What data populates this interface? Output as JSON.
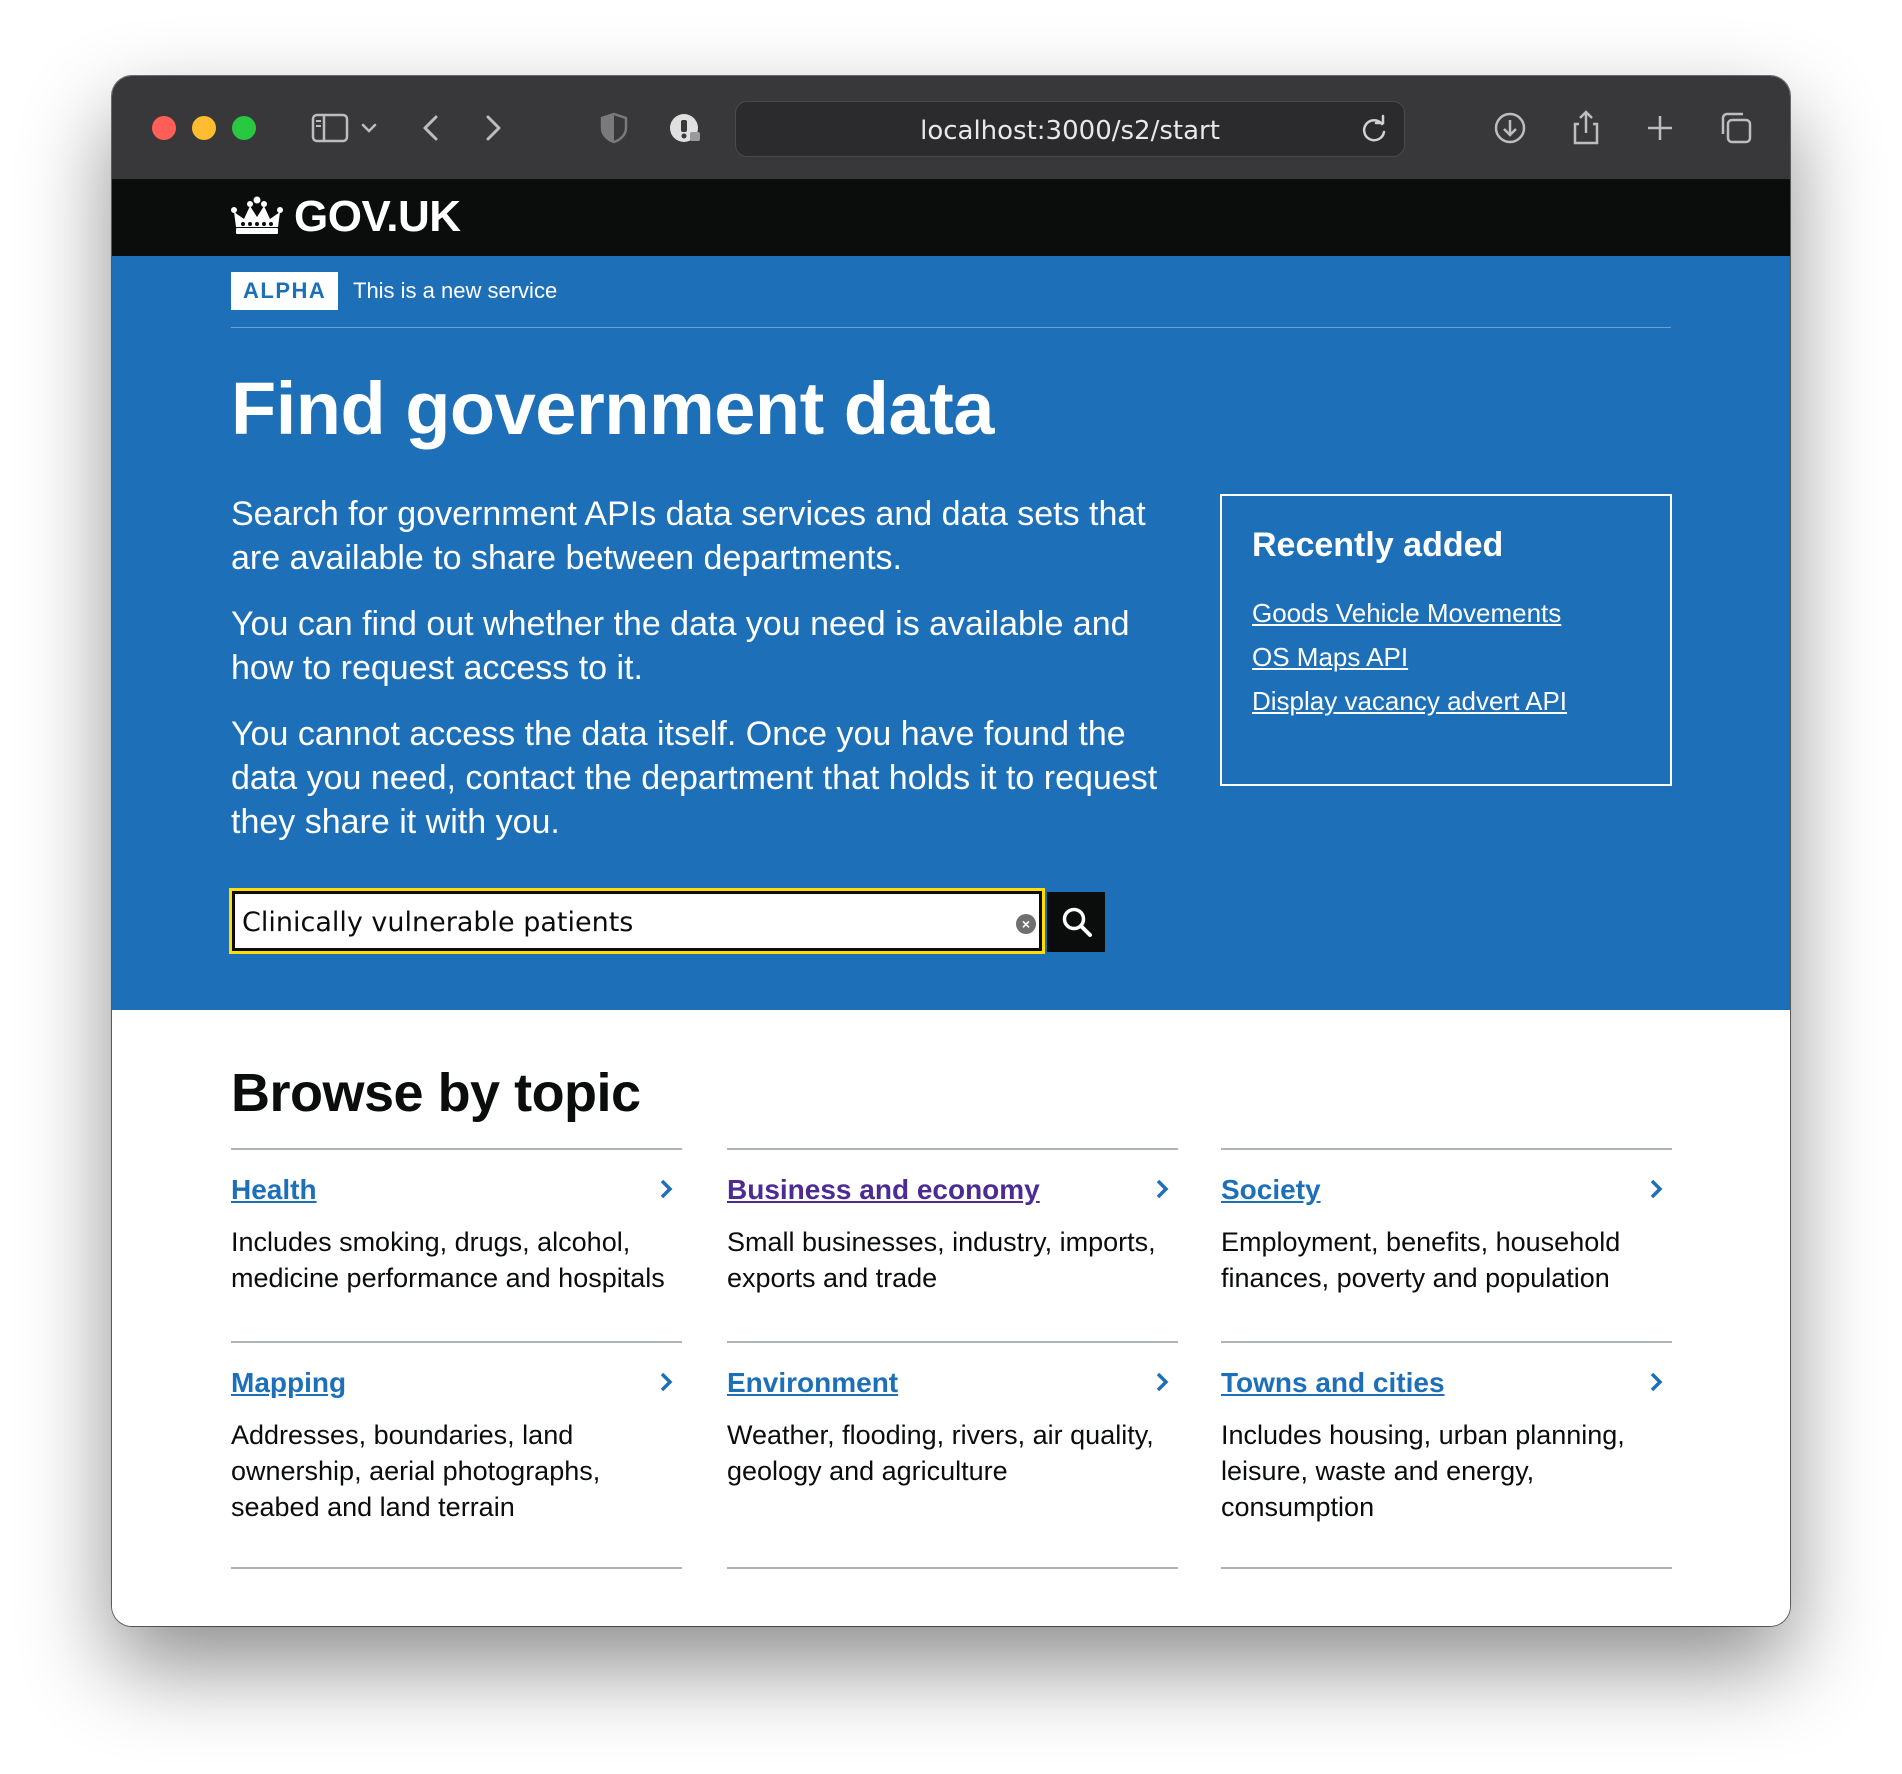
{
  "browser": {
    "url": "localhost:3000/s2/start"
  },
  "header": {
    "logo": "GOV.UK"
  },
  "phase_banner": {
    "tag": "ALPHA",
    "text": "This is a new service"
  },
  "hero": {
    "title": "Find government data",
    "paragraphs": [
      "Search for government APIs data services and data sets that are available to share between departments.",
      "You can find out whether the data you need is available and how to request access to it.",
      "You cannot access the data itself. Once you have found the data you need, contact the department that holds it to request they share it with you."
    ]
  },
  "recently_added": {
    "title": "Recently added",
    "links": [
      "Goods Vehicle Movements",
      "OS Maps API",
      "Display vacancy advert API"
    ]
  },
  "search": {
    "value": "Clinically vulnerable patients"
  },
  "browse": {
    "title": "Browse by topic",
    "topics": [
      {
        "label": "Health",
        "description": "Includes smoking, drugs, alcohol, medicine performance and hospitals"
      },
      {
        "label": "Business and economy",
        "description": "Small businesses, industry, imports, exports and trade"
      },
      {
        "label": "Society",
        "description": "Employment, benefits, household finances, poverty and population"
      },
      {
        "label": "Mapping",
        "description": "Addresses, boundaries, land ownership, aerial photographs, seabed and land terrain"
      },
      {
        "label": "Environment",
        "description": "Weather, flooding, rivers, air quality, geology and agriculture"
      },
      {
        "label": "Towns and cities",
        "description": "Includes housing, urban planning, leisure, waste and energy, consumption"
      }
    ]
  },
  "colors": {
    "govuk_blue": "#1d70b8",
    "govuk_black": "#0b0c0c",
    "focus_yellow": "#ffdd00",
    "visited_link": "#4c2c92",
    "chrome_bg": "#38383a"
  }
}
